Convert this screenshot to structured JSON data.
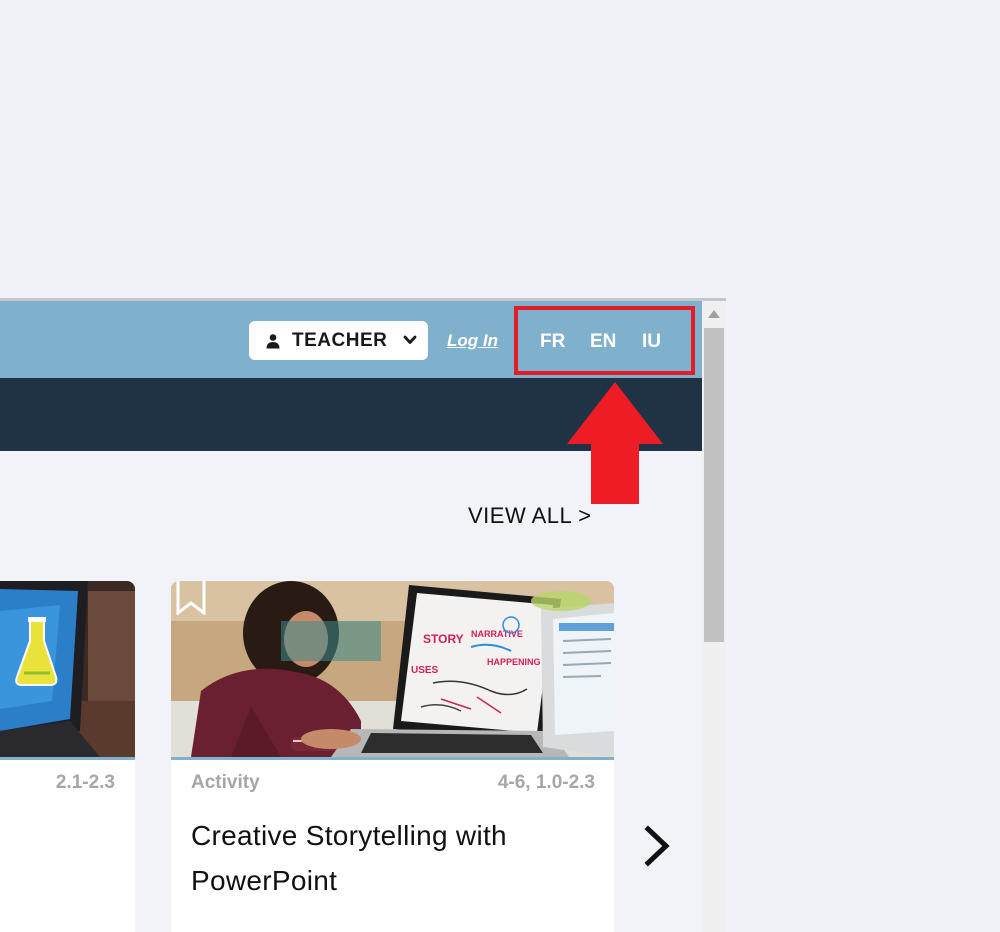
{
  "header": {
    "role_label": "TEACHER",
    "login_label": "Log In",
    "languages": [
      "FR",
      "EN",
      "IU"
    ]
  },
  "section": {
    "view_all_label": "VIEW ALL >"
  },
  "cards": [
    {
      "grade": "2.1-2.3"
    },
    {
      "type": "Activity",
      "grade": "4-6, 1.0-2.3",
      "title": "Creative Storytelling with PowerPoint"
    }
  ],
  "colors": {
    "topbar": "#7fb0cc",
    "navbar": "#1f3344",
    "highlight": "#e01f2a",
    "page_bg": "#f1f2f7"
  },
  "icons": {
    "role": "person-icon",
    "role_dropdown": "chevron-down-icon",
    "bookmark": "bookmark-icon",
    "carousel_next": "chevron-right-icon",
    "annotation": "arrow-up-icon"
  }
}
